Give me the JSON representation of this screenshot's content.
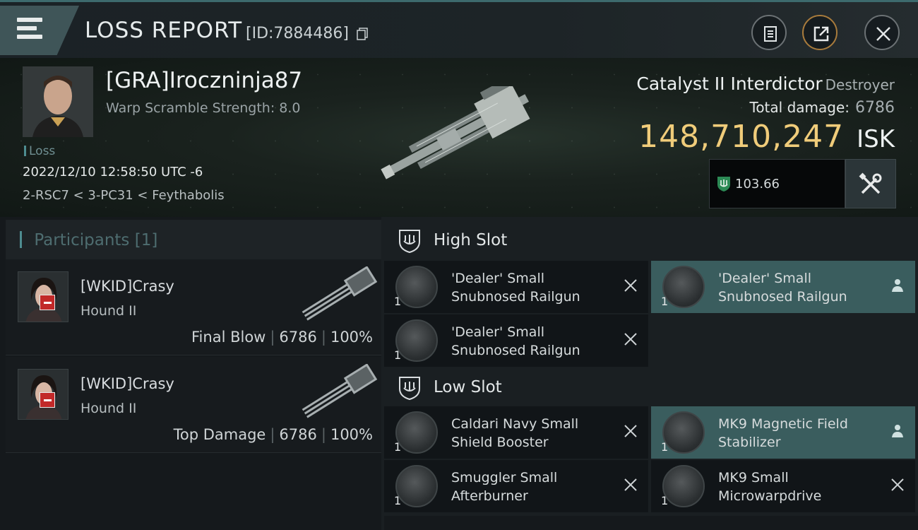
{
  "header": {
    "title": "LOSS REPORT",
    "report_id": "[ID:7884486]",
    "icons": [
      "menu-icon",
      "copy-icon",
      "clipboard-icon",
      "external-link-icon",
      "close-icon"
    ]
  },
  "victim": {
    "name": "[GRA]Iroczninja87",
    "warp_scramble": "Warp Scramble Strength: 8.0",
    "tag": "Loss",
    "datetime": "2022/12/10 12:58:50 UTC -6",
    "location": "2-RSC7 < 3-PC31 < Feythabolis"
  },
  "ship": {
    "name": "Catalyst II Interdictor",
    "class": "Destroyer",
    "total_damage_label": "Total damage:",
    "total_damage": "6786",
    "isk_value": "148,710,247",
    "isk_unit": "ISK",
    "ehp": "103.66"
  },
  "participants": {
    "title": "Participants",
    "count": "[1]",
    "rows": [
      {
        "name": "[WKID]Crasy",
        "ship": "Hound II",
        "role": "Final Blow",
        "damage": "6786",
        "percent": "100%"
      },
      {
        "name": "[WKID]Crasy",
        "ship": "Hound II",
        "role": "Top Damage",
        "damage": "6786",
        "percent": "100%"
      }
    ]
  },
  "fitting": {
    "high_slot": {
      "label": "High Slot",
      "modules": [
        {
          "name_line1": "'Dealer' Small",
          "name_line2": "Snubnosed Railgun",
          "qty": "1",
          "status": "destroyed"
        },
        {
          "name_line1": "'Dealer' Small",
          "name_line2": "Snubnosed Railgun",
          "qty": "1",
          "status": "dropped"
        },
        {
          "name_line1": "'Dealer' Small",
          "name_line2": "Snubnosed Railgun",
          "qty": "1",
          "status": "destroyed"
        }
      ]
    },
    "low_slot": {
      "label": "Low Slot",
      "modules": [
        {
          "name_line1": "Caldari Navy Small",
          "name_line2": "Shield Booster",
          "qty": "1",
          "status": "destroyed"
        },
        {
          "name_line1": "MK9 Magnetic Field",
          "name_line2": "Stabilizer",
          "qty": "1",
          "status": "dropped"
        },
        {
          "name_line1": "Smuggler Small",
          "name_line2": "Afterburner",
          "qty": "1",
          "status": "destroyed"
        },
        {
          "name_line1": "MK9 Small",
          "name_line2": "Microwarpdrive",
          "qty": "1",
          "status": "destroyed"
        }
      ]
    }
  },
  "colors": {
    "isk_gold": "#f0cc7a",
    "accent_teal": "#4e8c90",
    "dropped_highlight": "#3a5d5e",
    "destroyed_badge": "#c22929"
  }
}
